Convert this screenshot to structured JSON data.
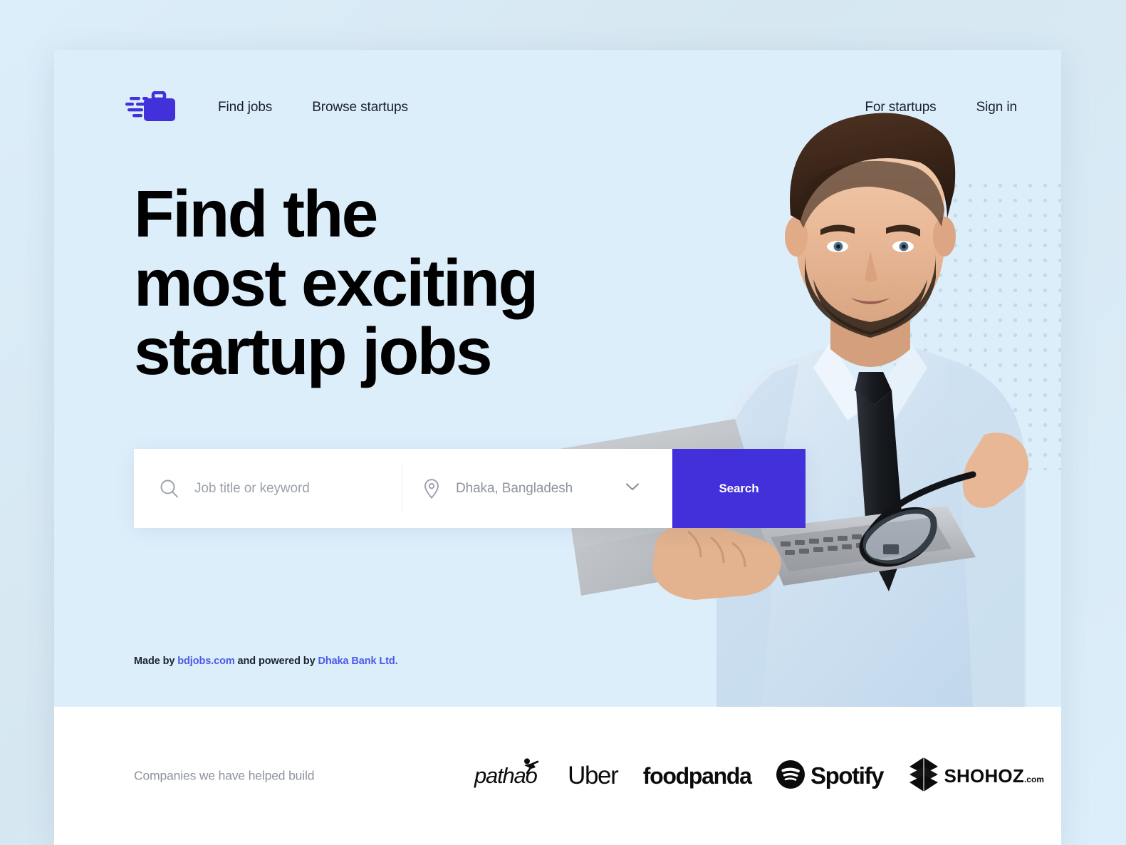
{
  "brand": {
    "logo_icon": "briefcase-motion-icon",
    "accent_color": "#4230db",
    "hero_bg_color": "#ddeefb",
    "page_bg_color": "#dceefa"
  },
  "nav": {
    "left_links": [
      {
        "label": "Find jobs",
        "name": "nav-link-find-jobs"
      },
      {
        "label": "Browse startups",
        "name": "nav-link-browse-startups"
      }
    ],
    "right_links": [
      {
        "label": "For startups",
        "name": "nav-link-for-startups"
      },
      {
        "label": "Sign in",
        "name": "nav-link-sign-in"
      }
    ]
  },
  "hero": {
    "headline_line1": "Find the",
    "headline_line2": "most exciting",
    "headline_line3": "startup jobs",
    "photo_alt": "Businessman in light blue shirt and dark tie holding a laptop and eyeglasses"
  },
  "search": {
    "keyword_icon": "search-icon",
    "keyword_placeholder": "Job title or keyword",
    "keyword_value": "",
    "location_icon": "location-pin-icon",
    "location_value": "Dhaka, Bangladesh",
    "location_chevron_icon": "chevron-down-icon",
    "button_label": "Search"
  },
  "credit": {
    "prefix": "Made by ",
    "link1": "bdjobs.com",
    "middle": " and powered by ",
    "link2": "Dhaka Bank Ltd.",
    "suffix": ""
  },
  "companies": {
    "label": "Companies we have helped build",
    "items": [
      {
        "name": "brand-pathao",
        "text": "pathao",
        "icon": "cyclist-icon"
      },
      {
        "name": "brand-uber",
        "text": "Uber",
        "icon": ""
      },
      {
        "name": "brand-foodpanda",
        "text": "foodpanda",
        "icon": ""
      },
      {
        "name": "brand-spotify",
        "text": "Spotify",
        "icon": "spotify-circle-icon"
      },
      {
        "name": "brand-shohoz",
        "text": "SHOHOZ",
        "suffix": ".com",
        "icon": "shohoz-diamond-icon"
      }
    ]
  }
}
